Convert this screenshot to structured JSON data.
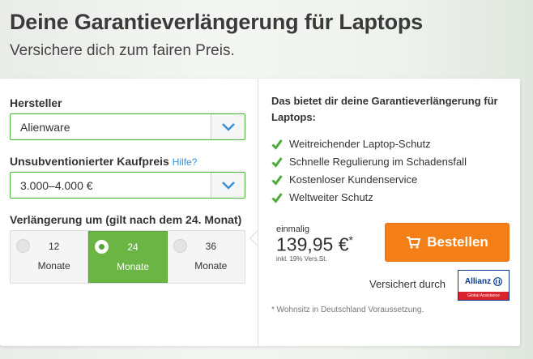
{
  "header": {
    "title": "Deine Garantieverlängerung für Laptops",
    "subtitle": "Versichere dich zum fairen Preis."
  },
  "form": {
    "manufacturer": {
      "label": "Hersteller",
      "value": "Alienware"
    },
    "price": {
      "label": "Unsubventionierter Kaufpreis",
      "help": "Hilfe?",
      "value": "3.000–4.000 €"
    },
    "extension": {
      "label": "Verlängerung um (gilt nach dem 24. Monat)",
      "options": [
        {
          "number": "12",
          "unit": "Monate",
          "selected": false
        },
        {
          "number": "24",
          "unit": "Monate",
          "selected": true
        },
        {
          "number": "36",
          "unit": "Monate",
          "selected": false
        }
      ]
    }
  },
  "benefits": {
    "title": "Das bietet dir deine Garantieverlängerung für Laptops:",
    "items": [
      "Weitreichender Laptop-Schutz",
      "Schnelle Regulierung im Schadensfall",
      "Kostenloser Kundenservice",
      "Weltweiter Schutz"
    ]
  },
  "pricing": {
    "frequency": "einmalig",
    "amount": "139,95 €",
    "asterisk": "*",
    "tax_note": "inkl. 19% Vers.St.",
    "order_button": "Bestellen"
  },
  "insurer": {
    "label": "Versichert durch",
    "brand": "Allianz",
    "tagline": "Global Assistance"
  },
  "footnote": "* Wohnsitz in Deutschland Voraussetzung.",
  "colors": {
    "accent_green": "#6ab544",
    "check_green": "#4fa83a",
    "order_orange": "#f57f17",
    "allianz_blue": "#0a3a8c",
    "allianz_red": "#d9232d"
  },
  "icons": {
    "dropdown": "chevron-down-icon",
    "check": "check-icon",
    "cart": "cart-icon"
  }
}
